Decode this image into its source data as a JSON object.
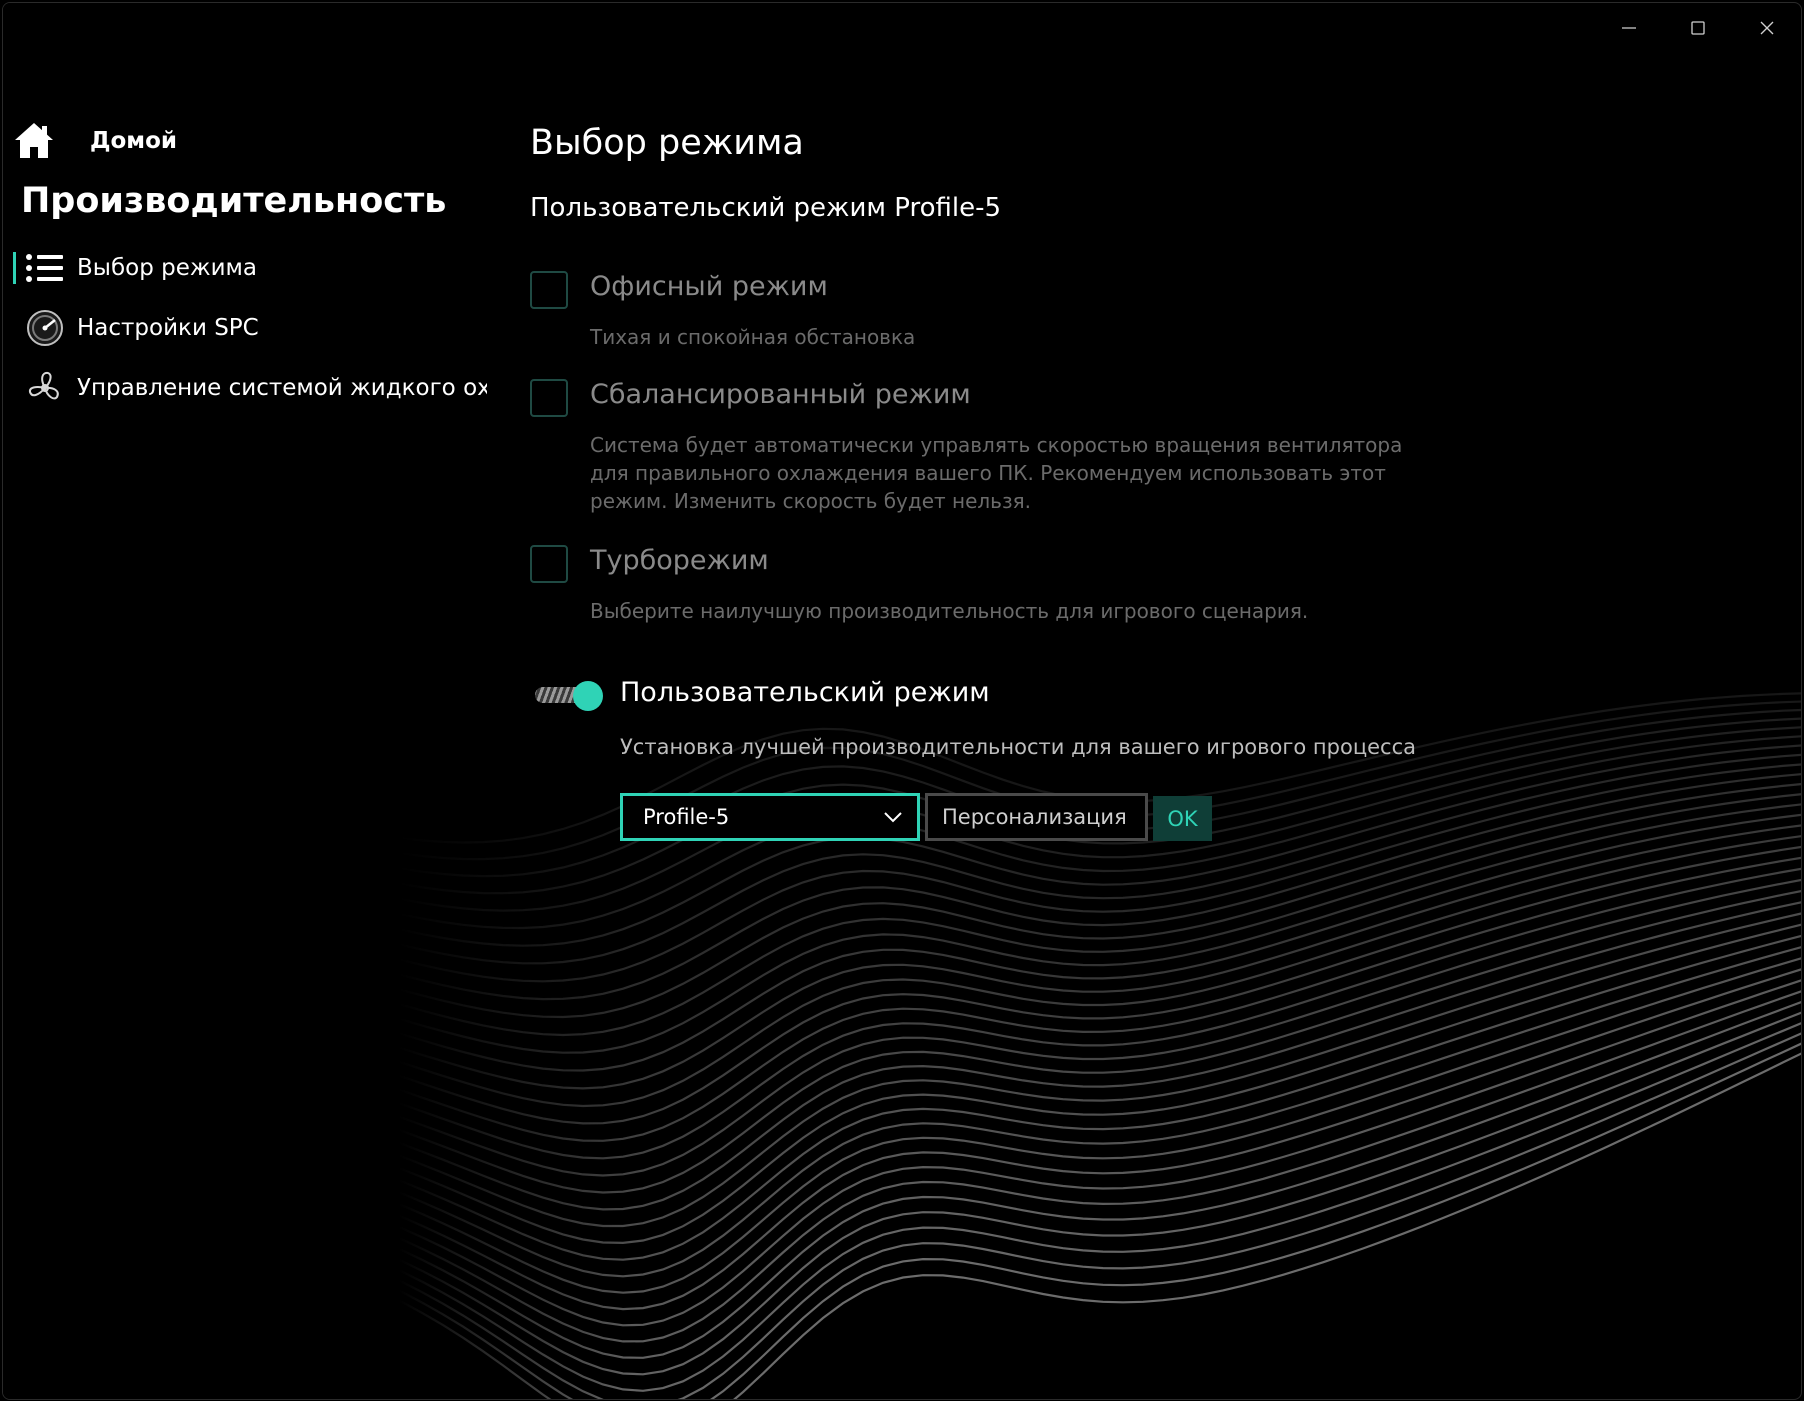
{
  "window": {
    "controls": {
      "minimize_icon": "minimize-icon",
      "maximize_icon": "maximize-icon",
      "close_icon": "close-icon"
    }
  },
  "sidebar": {
    "home_label": "Домой",
    "section_title": "Производительность",
    "items": [
      {
        "label": "Выбор режима",
        "icon": "list-icon",
        "active": true
      },
      {
        "label": "Настройки SPC",
        "icon": "gauge-icon",
        "active": false
      },
      {
        "label": "Управление системой жидкого охлаж",
        "icon": "fan-icon",
        "active": false
      }
    ]
  },
  "main": {
    "title": "Выбор режима",
    "subtitle": "Пользовательский режим Profile-5",
    "modes": [
      {
        "title": "Офисный режим",
        "description": "Тихая и спокойная обстановка",
        "checked": false
      },
      {
        "title": "Сбалансированный режим",
        "description": "Система будет автоматически управлять скоростью вращения вентилятора для правильного охлаждения вашего ПК. Рекомендуем использовать этот режим. Изменить скорость будет нельзя.",
        "checked": false
      },
      {
        "title": "Турборежим",
        "description": "Выберите наилучшую производительность для игрового сценария.",
        "checked": false
      }
    ],
    "custom": {
      "title": "Пользовательский режим",
      "description": "Установка лучшей производительности для вашего игрового процесса",
      "toggle_on": true,
      "selected_profile": "Profile-5",
      "personalize_placeholder": "Персонализация",
      "ok_label": "OK"
    }
  },
  "colors": {
    "accent": "#2fd3b6",
    "background": "#000000",
    "ok_bg": "#0f3e37"
  }
}
